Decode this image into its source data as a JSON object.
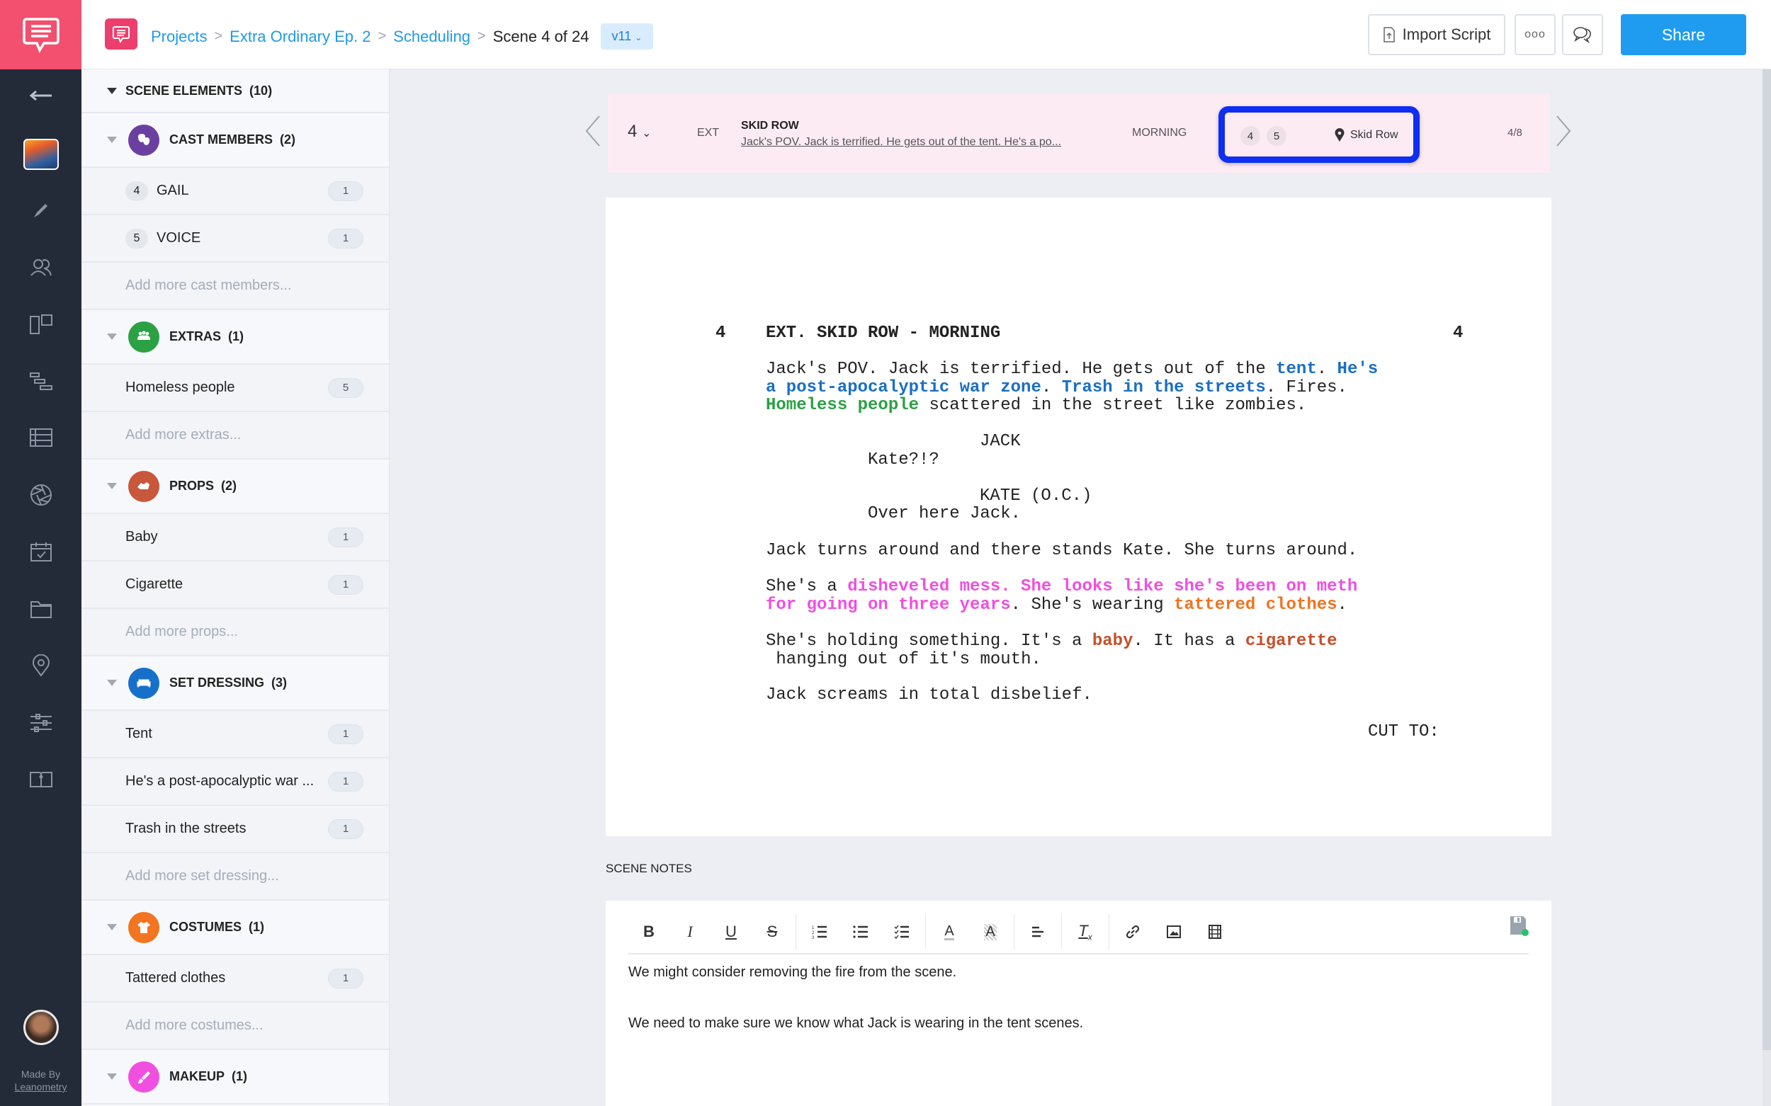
{
  "app": {
    "made_by_label": "Made By",
    "made_by_name": "Leanometry"
  },
  "rail": {
    "items": [
      "back-arrow",
      "project-thumbnail",
      "pencil",
      "users",
      "storyboard",
      "gantt",
      "stripboard",
      "camera-shutter",
      "calendar",
      "folder",
      "location-pin",
      "sliders",
      "book"
    ]
  },
  "breadcrumb": {
    "items": [
      "Projects",
      "Extra Ordinary Ep. 2",
      "Scheduling"
    ],
    "current": "Scene 4 of 24",
    "version": "v11"
  },
  "header": {
    "import_label": "Import Script",
    "more_label": "ooo",
    "share_label": "Share"
  },
  "elements": {
    "title": "SCENE ELEMENTS",
    "total": "(10)",
    "categories": [
      {
        "name": "CAST MEMBERS",
        "count": "(2)",
        "color": "#6b3fa0",
        "icon": "theater-masks",
        "items": [
          {
            "num": "4",
            "label": "GAIL",
            "count": "1"
          },
          {
            "num": "5",
            "label": "VOICE",
            "count": "1"
          }
        ],
        "add": "Add more cast members..."
      },
      {
        "name": "EXTRAS",
        "count": "(1)",
        "color": "#2ba144",
        "icon": "group",
        "items": [
          {
            "label": "Homeless people",
            "count": "5"
          }
        ],
        "add": "Add more extras..."
      },
      {
        "name": "PROPS",
        "count": "(2)",
        "color": "#c9573b",
        "icon": "hand-holding",
        "items": [
          {
            "label": "Baby",
            "count": "1"
          },
          {
            "label": "Cigarette",
            "count": "1"
          }
        ],
        "add": "Add more props..."
      },
      {
        "name": "SET DRESSING",
        "count": "(3)",
        "color": "#1670c9",
        "icon": "sofa",
        "items": [
          {
            "label": "Tent",
            "count": "1"
          },
          {
            "label": "He's a post-apocalyptic war ...",
            "count": "1"
          },
          {
            "label": "Trash in the streets",
            "count": "1"
          }
        ],
        "add": "Add more set dressing..."
      },
      {
        "name": "COSTUMES",
        "count": "(1)",
        "color": "#f37421",
        "icon": "shirt",
        "items": [
          {
            "label": "Tattered clothes",
            "count": "1"
          }
        ],
        "add": "Add more costumes..."
      },
      {
        "name": "MAKEUP",
        "count": "(1)",
        "color": "#f04fe0",
        "icon": "brush",
        "items": [],
        "add": ""
      }
    ]
  },
  "strip": {
    "scene_number": "4",
    "int_ext": "EXT",
    "title": "SKID ROW",
    "description": "Jack's POV. Jack is terrified. He gets out of the tent. He's a po...",
    "time": "MORNING",
    "cast_ids": [
      "4",
      "5"
    ],
    "location": "Skid Row",
    "pages": "4/8"
  },
  "script": {
    "scene_num": "4",
    "slugline": "EXT. SKID ROW - MORNING",
    "p1": [
      {
        "t": "Jack's POV. Jack is terrified. He gets out of the ",
        "c": ""
      },
      {
        "t": "tent",
        "c": "c-blue"
      },
      {
        "t": ". ",
        "c": ""
      },
      {
        "t": "He's\na post-apocalyptic war zone",
        "c": "c-blue"
      },
      {
        "t": ". ",
        "c": ""
      },
      {
        "t": "Trash in the streets",
        "c": "c-blue"
      },
      {
        "t": ". Fires.\n",
        "c": ""
      },
      {
        "t": "Homeless people",
        "c": "c-green"
      },
      {
        "t": " scattered in the street like zombies.",
        "c": ""
      }
    ],
    "char1": "JACK",
    "dial1": "Kate?!?",
    "char2": "KATE (O.C.)",
    "dial2": "Over here Jack.",
    "p2": "Jack turns around and there stands Kate. She turns around.",
    "p3": [
      {
        "t": "She's a ",
        "c": ""
      },
      {
        "t": "disheveled mess. She looks like she's been on meth\nfor going on three years",
        "c": "c-pink"
      },
      {
        "t": ". She's wearing ",
        "c": ""
      },
      {
        "t": "tattered clothes",
        "c": "c-orange"
      },
      {
        "t": ".",
        "c": ""
      }
    ],
    "p4": [
      {
        "t": "She's holding something. It's a ",
        "c": ""
      },
      {
        "t": "baby",
        "c": "c-rust"
      },
      {
        "t": ". It has a ",
        "c": ""
      },
      {
        "t": "cigarette",
        "c": "c-rust"
      },
      {
        "t": "\n hanging out of it's mouth.",
        "c": ""
      }
    ],
    "p5": "Jack screams in total disbelief.",
    "transition": "CUT TO:"
  },
  "notes": {
    "label": "SCENE NOTES",
    "lines": [
      "We might consider removing the fire from the scene.",
      "We need to make sure we know what Jack is wearing in the tent scenes."
    ],
    "toolbar": [
      "bold",
      "italic",
      "underline",
      "strikethrough",
      "ordered-list",
      "bullet-list",
      "checklist",
      "text-color",
      "highlight",
      "align",
      "clear-format",
      "link",
      "image",
      "video"
    ]
  }
}
